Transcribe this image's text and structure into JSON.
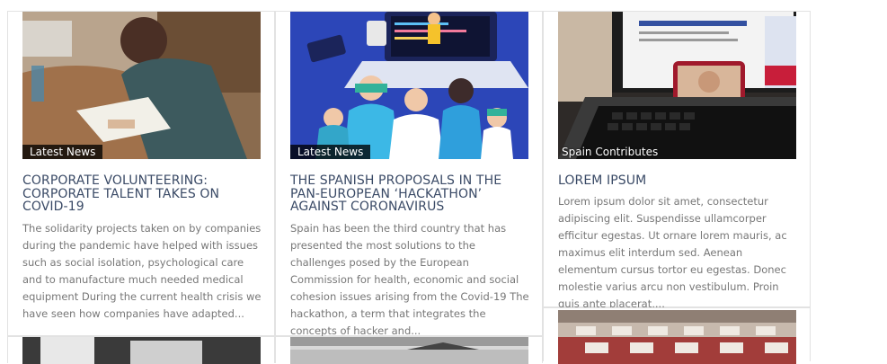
{
  "cards": [
    {
      "category": "Latest News",
      "title": "CORPORATE VOLUNTEERING: CORPORATE TALENT TAKES ON COVID-19",
      "excerpt": "The solidarity projects taken on by companies during the pandemic have helped with issues such as social isolation, psychological care and to manufacture much needed medical equipment During the current health crisis we have seen how companies have adapted..."
    },
    {
      "category": "Latest News",
      "title": "THE SPANISH PROPOSALS IN THE PAN-EUROPEAN ‘HACKATHON’ AGAINST CORONAVIRUS",
      "excerpt": "Spain has been the third country that has presented the most solutions to the challenges posed by the European Commission for health, economic and social cohesion issues arising from the Covid-19   The hackathon, a term that integrates the concepts of hacker and..."
    },
    {
      "category": "Spain Contributes",
      "title": "LOREM IPSUM",
      "excerpt": "Lorem ipsum dolor sit amet, consectetur adipiscing elit. Suspendisse ullamcorper efficitur egestas. Ut ornare lorem mauris, ac maximus elit interdum sed. Aenean elementum cursus tortor eu egestas. Donec molestie varius arcu non vestibulum. Proin quis ante placerat,..."
    }
  ]
}
